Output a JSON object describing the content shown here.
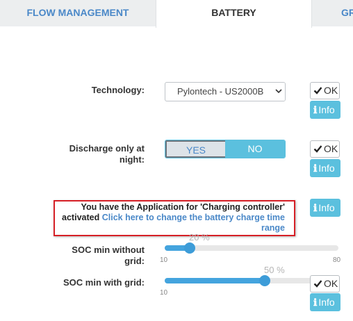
{
  "tabs": {
    "flow": "FLOW MANAGEMENT",
    "battery": "BATTERY",
    "grid": "GR"
  },
  "technology": {
    "label": "Technology:",
    "selected": "Pylontech - US2000B"
  },
  "discharge": {
    "label_line1": "Discharge only at",
    "label_line2": "night:",
    "yes": "YES",
    "no": "NO",
    "value": "NO"
  },
  "buttons": {
    "ok": "OK",
    "info": "Info"
  },
  "alert": {
    "text": "You have the Application for 'Charging controller' activated",
    "link": "Click here to change the battery charge time range"
  },
  "soc_without_grid": {
    "label_line1": "SOC min without",
    "label_line2": "grid:",
    "value_text": "20 %",
    "value": 20,
    "min": 10,
    "max": 80,
    "min_label": "10",
    "max_label": "80"
  },
  "soc_with_grid": {
    "label": "SOC min with grid:",
    "value_text": "50 %",
    "value": 50,
    "min": 10,
    "min_label": "10"
  },
  "colors": {
    "accent": "#5bc0de",
    "link": "#4a88c8",
    "alert_border": "#d61f26",
    "slider": "#44a4de"
  }
}
